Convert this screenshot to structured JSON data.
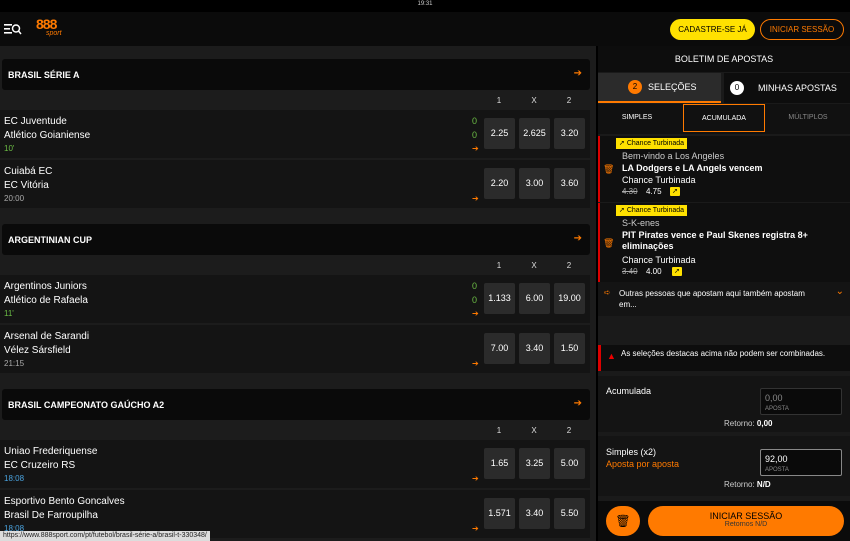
{
  "status_time": "19:31",
  "header": {
    "logo_num": "888",
    "logo_sub": "sport",
    "signup": "CADASTRE-SE JÁ",
    "login": "INICIAR SESSÃO"
  },
  "leagues": [
    {
      "title": "BRASIL SÉRIE A",
      "cols": [
        "1",
        "X",
        "2"
      ],
      "matches": [
        {
          "home": "EC Juventude",
          "away": "Atlético Goianiense",
          "time": "10'",
          "time_style": "live",
          "score_home": "0",
          "score_away": "0",
          "odds": [
            "2.25",
            "2.625",
            "3.20"
          ]
        },
        {
          "home": "Cuiabá EC",
          "away": "EC Vitória",
          "time": "20:00",
          "time_style": "",
          "odds": [
            "2.20",
            "3.00",
            "3.60"
          ]
        }
      ]
    },
    {
      "title": "ARGENTINIAN CUP",
      "cols": [
        "1",
        "X",
        "2"
      ],
      "matches": [
        {
          "home": "Argentinos Juniors",
          "away": "Atlético de Rafaela",
          "time": "11'",
          "time_style": "live",
          "score_home": "0",
          "score_away": "0",
          "odds": [
            "1.133",
            "6.00",
            "19.00"
          ]
        },
        {
          "home": "Arsenal de Sarandi",
          "away": "Vélez Sársfield",
          "time": "21:15",
          "time_style": "",
          "odds": [
            "7.00",
            "3.40",
            "1.50"
          ]
        }
      ]
    },
    {
      "title": "BRASIL CAMPEONATO GAÚCHO A2",
      "cols": [
        "1",
        "X",
        "2"
      ],
      "matches": [
        {
          "home": "Uniao Frederiquense",
          "away": "EC Cruzeiro RS",
          "time": "18:08",
          "time_style": "blue",
          "odds": [
            "1.65",
            "3.25",
            "5.00"
          ]
        },
        {
          "home": "Esportivo Bento Goncalves",
          "away": "Brasil De Farroupilha",
          "time": "18:08",
          "time_style": "blue",
          "odds": [
            "1.571",
            "3.40",
            "5.50"
          ]
        }
      ]
    }
  ],
  "betslip": {
    "title": "BOLETIM DE APOSTAS",
    "tab_sel_count": "2",
    "tab_sel": "SELEÇÕES",
    "tab_mine_count": "0",
    "tab_mine": "MINHAS APOSTAS",
    "sub_tabs": [
      "SIMPLES",
      "ACUMULADA",
      "MÚLTIPLOS"
    ],
    "selections": [
      {
        "tag": "Chance Turbinada",
        "event": "Bem-vindo a Los Angeles",
        "market": "LA Dodgers e LA Angels vencem",
        "type": "Chance Turbinada",
        "old": "4.30",
        "new": "4.75"
      },
      {
        "tag": "Chance Turbinada",
        "event": "S-K-enes",
        "market": "PIT Pirates vence e Paul Skenes registra 8+ eliminações",
        "type": "Chance Turbinada",
        "old": "3.40",
        "new": "4.00"
      }
    ],
    "others": "Outras pessoas que apostam aqui também apostam em...",
    "warning": "As seleções destacas acima não podem ser combinadas.",
    "acc_label": "Acumulada",
    "acc_value": "0,00",
    "acc_input_label": "APOSTA",
    "acc_ret_label": "Retorno:",
    "acc_ret": "0,00",
    "simp_label": "Simples (x2)",
    "simp_sub": "Aposta por aposta",
    "simp_value": "92,00",
    "simp_input_label": "APOSTA",
    "simp_ret_label": "Retorno:",
    "simp_ret": "N/D",
    "login_btn": "INICIAR SESSÃO",
    "login_sub": "Retornos N/D"
  },
  "url": "https://www.888sport.com/pt/futebol/brasil-série-a/brasil-t-330348/",
  "colors": {
    "accent": "#ff7a00",
    "yellow": "#ffe100",
    "live": "#6cbd45"
  }
}
